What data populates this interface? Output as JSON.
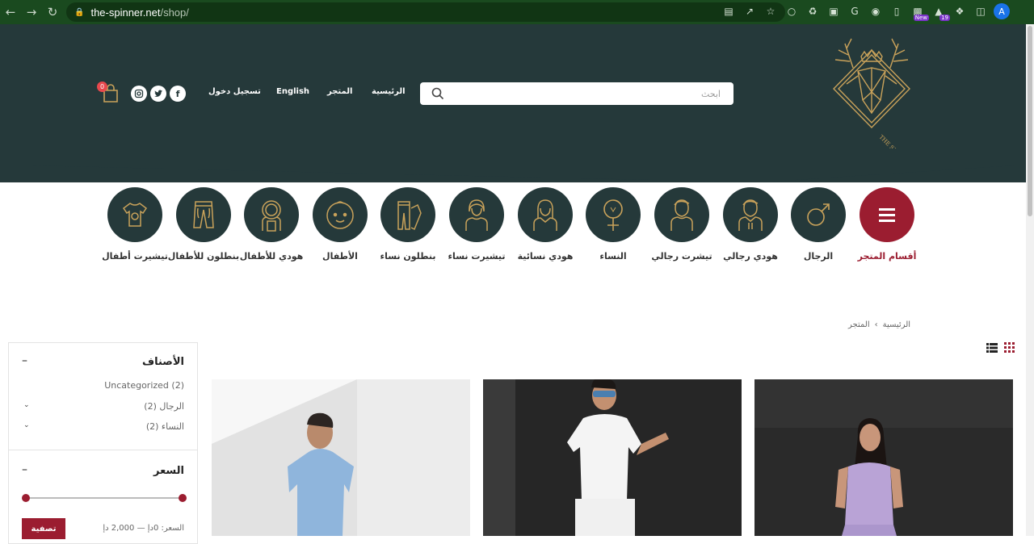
{
  "browser": {
    "url_host": "the-spinner.net",
    "url_path": "/shop/",
    "profile_initial": "A",
    "ext_new_badge": "New",
    "ext_count_badge": "19"
  },
  "header": {
    "search_placeholder": "ابحث",
    "menu": {
      "home": "الرئيسية",
      "shop": "المتجر",
      "english": "English",
      "login": "تسجيل دخول"
    },
    "cart_count": "0"
  },
  "categories": [
    {
      "label": "أقسام المتجر",
      "icon": "hamburger-icon"
    },
    {
      "label": "الرجال",
      "icon": "male-symbol-icon"
    },
    {
      "label": "هودي رجالي",
      "icon": "man-hoodie-icon"
    },
    {
      "label": "تيشرت رجالي",
      "icon": "man-tshirt-icon"
    },
    {
      "label": "النساء",
      "icon": "female-symbol-icon"
    },
    {
      "label": "هودي نسائية",
      "icon": "woman-hoodie-icon"
    },
    {
      "label": "تيشيرت نساء",
      "icon": "woman-tshirt-icon"
    },
    {
      "label": "بنطلون نساء",
      "icon": "pants-icon"
    },
    {
      "label": "الأطفال",
      "icon": "baby-face-icon"
    },
    {
      "label": "هودي للأطفال",
      "icon": "kid-hoodie-icon"
    },
    {
      "label": "بنطلون للأطفال",
      "icon": "kid-pants-icon"
    },
    {
      "label": "تيشيرت أطفال",
      "icon": "kid-tshirt-icon"
    }
  ],
  "breadcrumb": {
    "home": "الرئيسية",
    "separator": "›",
    "current": "المتجر"
  },
  "sidebar": {
    "categories_title": "الأصناف",
    "items": [
      {
        "label": "Uncategorized (2)"
      },
      {
        "label": "الرجال (2)"
      },
      {
        "label": "النساء (2)"
      }
    ],
    "price_title": "السعر",
    "filter_button": "تصفية",
    "price_text": "السعر: 0دإ — 2,000 دإ",
    "collapse_symbol": "–"
  },
  "colors": {
    "header_bg": "#25393a",
    "accent": "#9b1d30",
    "gold": "#c9a25a"
  }
}
